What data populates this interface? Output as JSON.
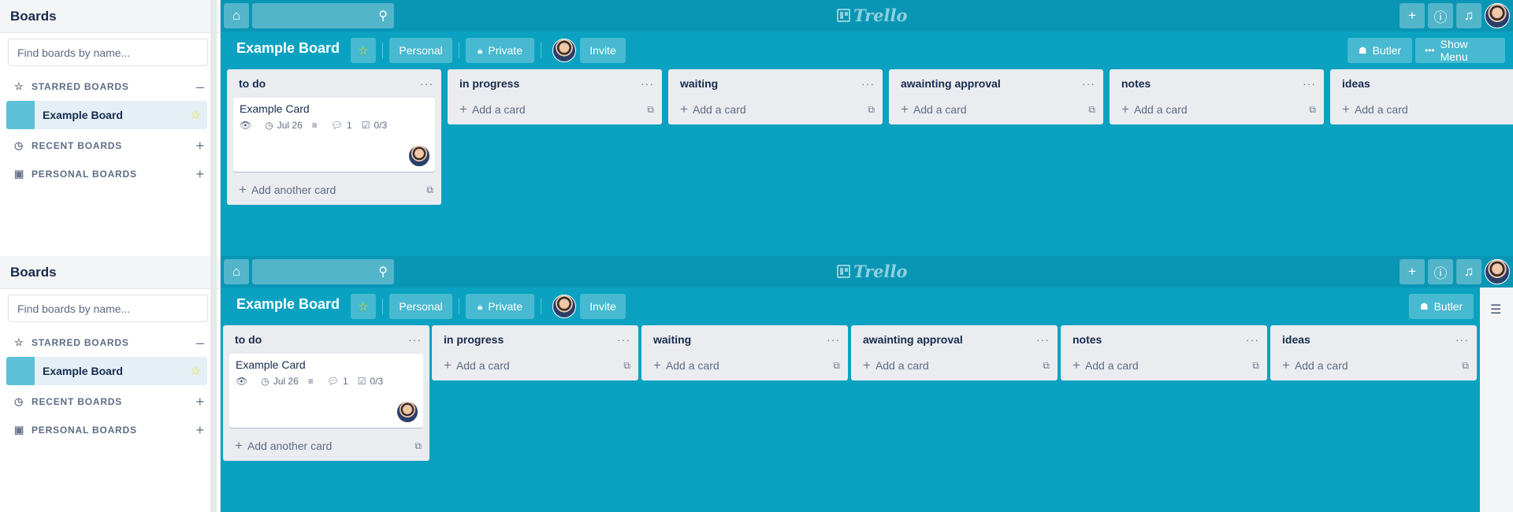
{
  "sidebar": {
    "title": "Boards",
    "search_placeholder": "Find boards by name...",
    "sections": {
      "starred": "STARRED BOARDS",
      "recent": "RECENT BOARDS",
      "personal": "PERSONAL BOARDS"
    },
    "starred_board": "Example Board"
  },
  "nav": {
    "logo": "Trello",
    "icons": [
      "home-icon",
      "search-icon",
      "plus-icon",
      "info-icon",
      "bell-icon"
    ]
  },
  "board": {
    "title": "Example Board",
    "team_label": "Personal",
    "visibility_label": "Private",
    "invite_label": "Invite",
    "butler_label": "Butler",
    "show_menu_label": "Show Menu"
  },
  "lists": [
    {
      "title": "to do",
      "add_label": "Add another card"
    },
    {
      "title": "in progress",
      "add_label": "Add a card"
    },
    {
      "title": "waiting",
      "add_label": "Add a card"
    },
    {
      "title": "awainting approval",
      "add_label": "Add a card"
    },
    {
      "title": "notes",
      "add_label": "Add a card"
    },
    {
      "title": "ideas",
      "add_label": "Add a card"
    }
  ],
  "card": {
    "title": "Example Card",
    "due": "Jul 26",
    "comments": "1",
    "checklist": "0/3"
  },
  "colors": {
    "board_bg": "#0aa2c0",
    "star": "#f2d600"
  }
}
